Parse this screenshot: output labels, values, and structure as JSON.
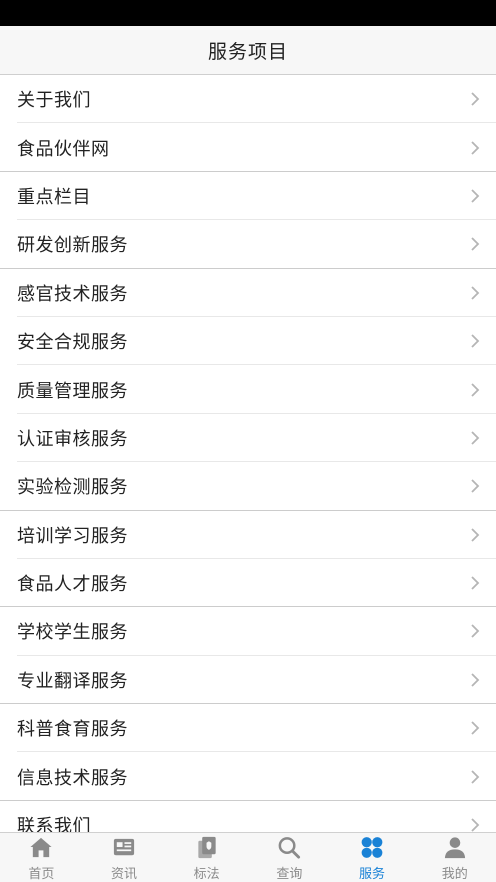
{
  "header": {
    "title": "服务项目"
  },
  "services": [
    {
      "label": "关于我们",
      "divider": "inset"
    },
    {
      "label": "食品伙伴网",
      "divider": "full"
    },
    {
      "label": "重点栏目",
      "divider": "inset"
    },
    {
      "label": "研发创新服务",
      "divider": "full"
    },
    {
      "label": "感官技术服务",
      "divider": "inset"
    },
    {
      "label": "安全合规服务",
      "divider": "inset"
    },
    {
      "label": "质量管理服务",
      "divider": "inset"
    },
    {
      "label": "认证审核服务",
      "divider": "inset"
    },
    {
      "label": "实验检测服务",
      "divider": "full"
    },
    {
      "label": "培训学习服务",
      "divider": "inset"
    },
    {
      "label": "食品人才服务",
      "divider": "full"
    },
    {
      "label": "学校学生服务",
      "divider": "inset"
    },
    {
      "label": "专业翻译服务",
      "divider": "full"
    },
    {
      "label": "科普食育服务",
      "divider": "inset"
    },
    {
      "label": "信息技术服务",
      "divider": "full"
    },
    {
      "label": "联系我们",
      "divider": "none"
    }
  ],
  "tabbar": {
    "active_color": "#1a82d6",
    "inactive_color": "#8a8a8a",
    "tabs": [
      {
        "label": "首页",
        "icon": "home-icon",
        "active": false
      },
      {
        "label": "资讯",
        "icon": "news-icon",
        "active": false
      },
      {
        "label": "标法",
        "icon": "standards-icon",
        "active": false
      },
      {
        "label": "查询",
        "icon": "search-icon",
        "active": false
      },
      {
        "label": "服务",
        "icon": "services-icon",
        "active": true
      },
      {
        "label": "我的",
        "icon": "profile-icon",
        "active": false
      }
    ]
  }
}
